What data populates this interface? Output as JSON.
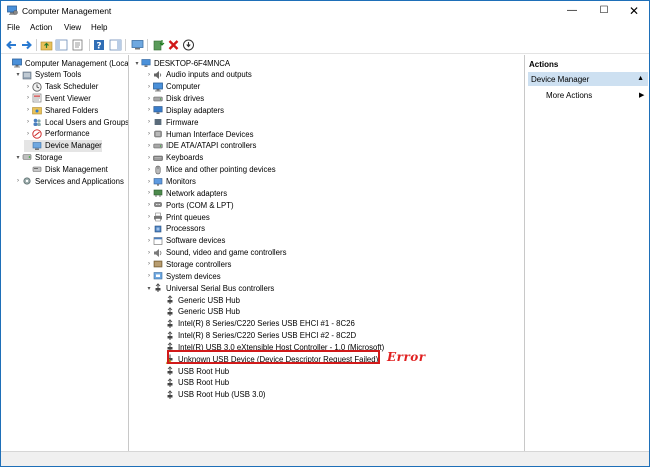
{
  "window": {
    "title": "Computer Management"
  },
  "menu": [
    "File",
    "Action",
    "View",
    "Help"
  ],
  "left_tree": [
    {
      "label": "Computer Management (Local",
      "icon": "computer-management-icon",
      "indent": 0,
      "twisty": "",
      "selected": false
    },
    {
      "label": "System Tools",
      "icon": "system-tools-icon",
      "indent": 1,
      "twisty": "▾",
      "selected": false
    },
    {
      "label": "Task Scheduler",
      "icon": "task-scheduler-icon",
      "indent": 2,
      "twisty": "›",
      "selected": false
    },
    {
      "label": "Event Viewer",
      "icon": "event-viewer-icon",
      "indent": 2,
      "twisty": "›",
      "selected": false
    },
    {
      "label": "Shared Folders",
      "icon": "shared-folders-icon",
      "indent": 2,
      "twisty": "›",
      "selected": false
    },
    {
      "label": "Local Users and Groups",
      "icon": "local-users-icon",
      "indent": 2,
      "twisty": "›",
      "selected": false
    },
    {
      "label": "Performance",
      "icon": "performance-icon",
      "indent": 2,
      "twisty": "›",
      "selected": false
    },
    {
      "label": "Device Manager",
      "icon": "device-manager-icon",
      "indent": 2,
      "twisty": "",
      "selected": true
    },
    {
      "label": "Storage",
      "icon": "storage-icon",
      "indent": 1,
      "twisty": "▾",
      "selected": false
    },
    {
      "label": "Disk Management",
      "icon": "disk-management-icon",
      "indent": 2,
      "twisty": "",
      "selected": false
    },
    {
      "label": "Services and Applications",
      "icon": "services-icon",
      "indent": 1,
      "twisty": "›",
      "selected": false
    }
  ],
  "device_tree": {
    "root": "DESKTOP-6F4MNCA",
    "categories": [
      "Audio inputs and outputs",
      "Computer",
      "Disk drives",
      "Display adapters",
      "Firmware",
      "Human Interface Devices",
      "IDE ATA/ATAPI controllers",
      "Keyboards",
      "Mice and other pointing devices",
      "Monitors",
      "Network adapters",
      "Ports (COM & LPT)",
      "Print queues",
      "Processors",
      "Software devices",
      "Sound, video and game controllers",
      "Storage controllers",
      "System devices"
    ],
    "expanded_category": "Universal Serial Bus controllers",
    "usb_devices": [
      "Generic USB Hub",
      "Generic USB Hub",
      "Intel(R) 8 Series/C220 Series USB EHCI #1 - 8C26",
      "Intel(R) 8 Series/C220 Series USB EHCI #2 - 8C2D",
      "Intel(R) USB 3.0 eXtensible Host Controller - 1.0 (Microsoft)",
      "Unknown USB Device (Device Descriptor Request Failed)",
      "USB Root Hub",
      "USB Root Hub",
      "USB Root Hub (USB 3.0)"
    ],
    "error_device_index": 5
  },
  "annotation": {
    "label": "Error",
    "color": "#e02020"
  },
  "actions": {
    "header": "Actions",
    "section": "Device Manager",
    "items": [
      "More Actions"
    ]
  },
  "colors": {
    "accent": "#1e6fb8",
    "section_bg": "#cde0f1",
    "selected_bg": "#e5e5e5"
  }
}
